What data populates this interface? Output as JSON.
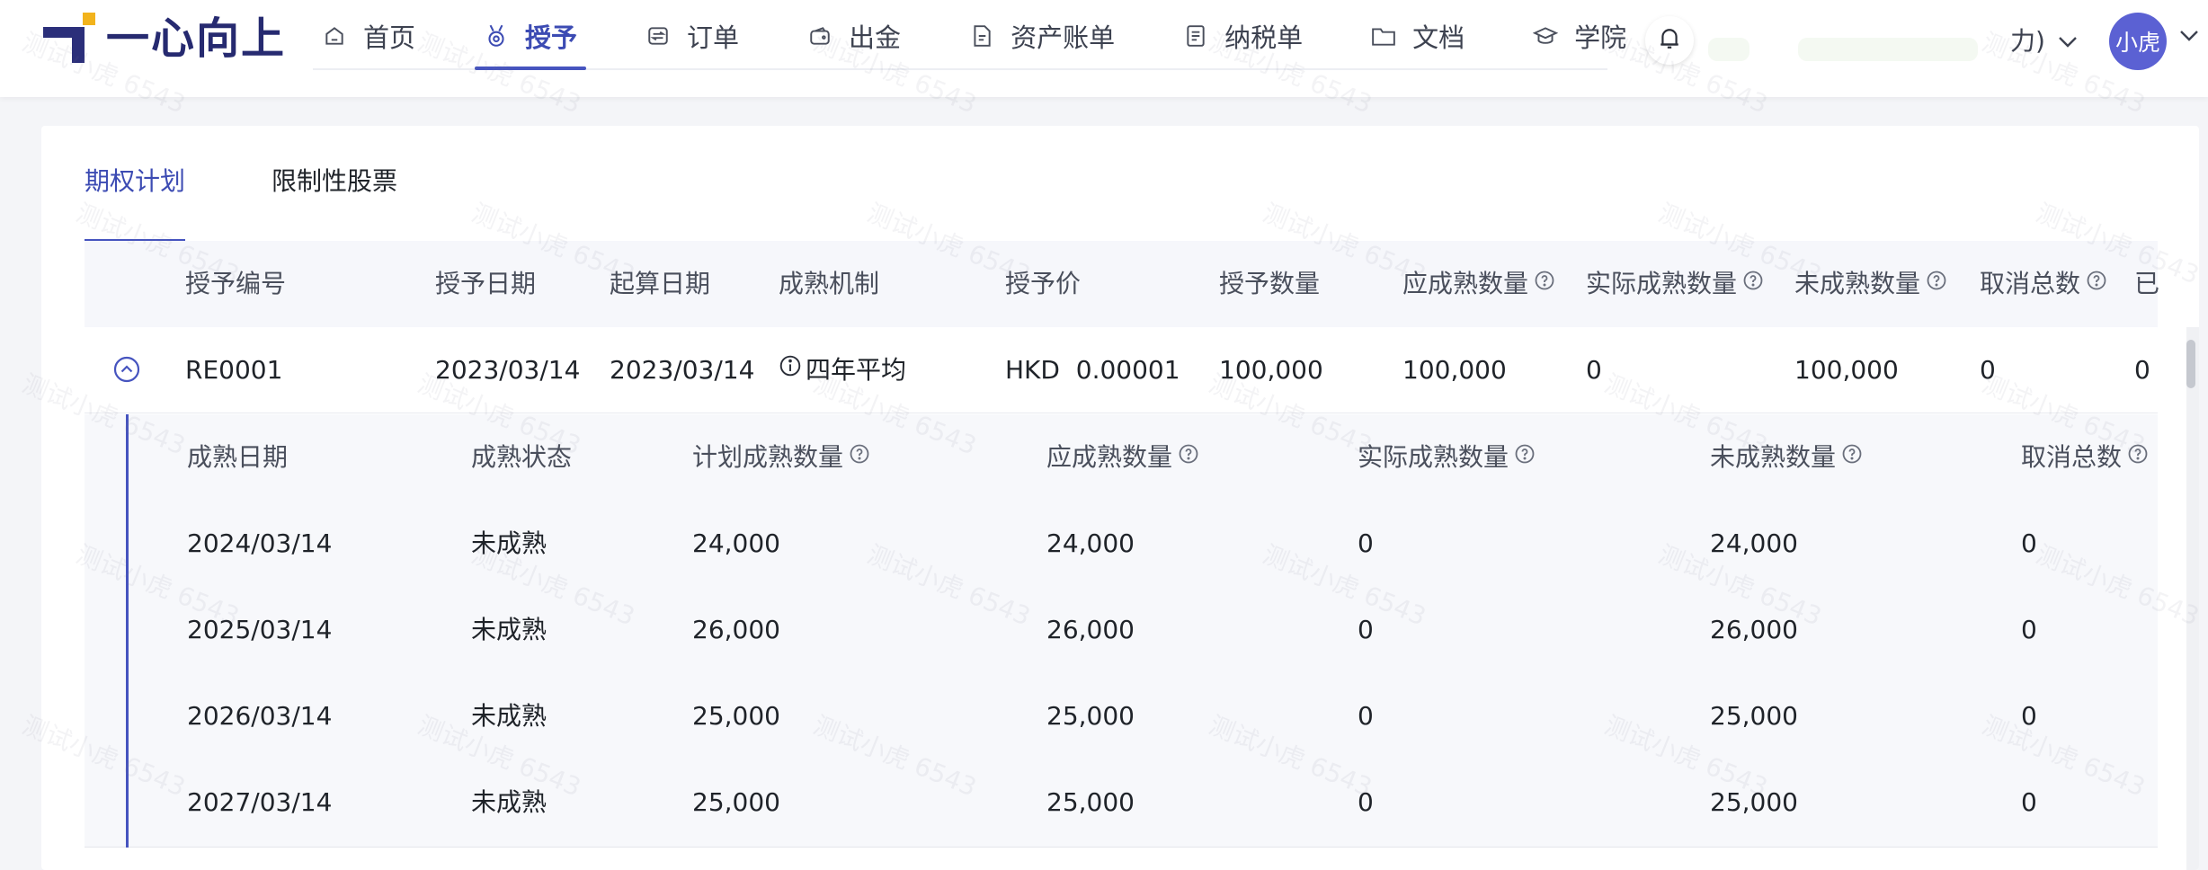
{
  "brand": {
    "name": "一心向上",
    "colors": {
      "primary": "#4654bf",
      "logo_dark": "#262a70",
      "logo_accent": "#f2b31c"
    }
  },
  "nav": {
    "items": [
      {
        "label": "首页",
        "icon": "home-icon"
      },
      {
        "label": "授予",
        "icon": "award-medal-icon",
        "active": true
      },
      {
        "label": "订单",
        "icon": "exchange-order-icon"
      },
      {
        "label": "出金",
        "icon": "wallet-icon"
      },
      {
        "label": "资产账单",
        "icon": "document-icon"
      },
      {
        "label": "纳税单",
        "icon": "tax-list-icon"
      },
      {
        "label": "文档",
        "icon": "folder-icon"
      },
      {
        "label": "学院",
        "icon": "academy-cap-icon"
      }
    ]
  },
  "header": {
    "lang_label": "力)",
    "avatar_text": "小虎"
  },
  "tabs": [
    {
      "label": "期权计划",
      "active": true
    },
    {
      "label": "限制性股票",
      "active": false
    }
  ],
  "table": {
    "columns": [
      "授予编号",
      "授予日期",
      "起算日期",
      "成熟机制",
      "授予价",
      "授予数量",
      "应成熟数量",
      "实际成熟数量",
      "未成熟数量",
      "取消总数",
      "已"
    ],
    "row": {
      "grant_id": "RE0001",
      "grant_date": "2023/03/14",
      "start_date": "2023/03/14",
      "vesting": "四年平均",
      "price": "HKD  0.00001",
      "grant_qty": "100,000",
      "due_vested": "100,000",
      "actual_vested": "0",
      "unvested": "100,000",
      "cancelled": "0",
      "extra": "0"
    },
    "sub_columns": [
      "成熟日期",
      "成熟状态",
      "计划成熟数量",
      "应成熟数量",
      "实际成熟数量",
      "未成熟数量",
      "取消总数"
    ],
    "sub_rows": [
      [
        "2024/03/14",
        "未成熟",
        "24,000",
        "24,000",
        "0",
        "24,000",
        "0"
      ],
      [
        "2025/03/14",
        "未成熟",
        "26,000",
        "26,000",
        "0",
        "26,000",
        "0"
      ],
      [
        "2026/03/14",
        "未成熟",
        "25,000",
        "25,000",
        "0",
        "25,000",
        "0"
      ],
      [
        "2027/03/14",
        "未成熟",
        "25,000",
        "25,000",
        "0",
        "25,000",
        "0"
      ]
    ]
  },
  "watermark": "测试小虎 6543"
}
